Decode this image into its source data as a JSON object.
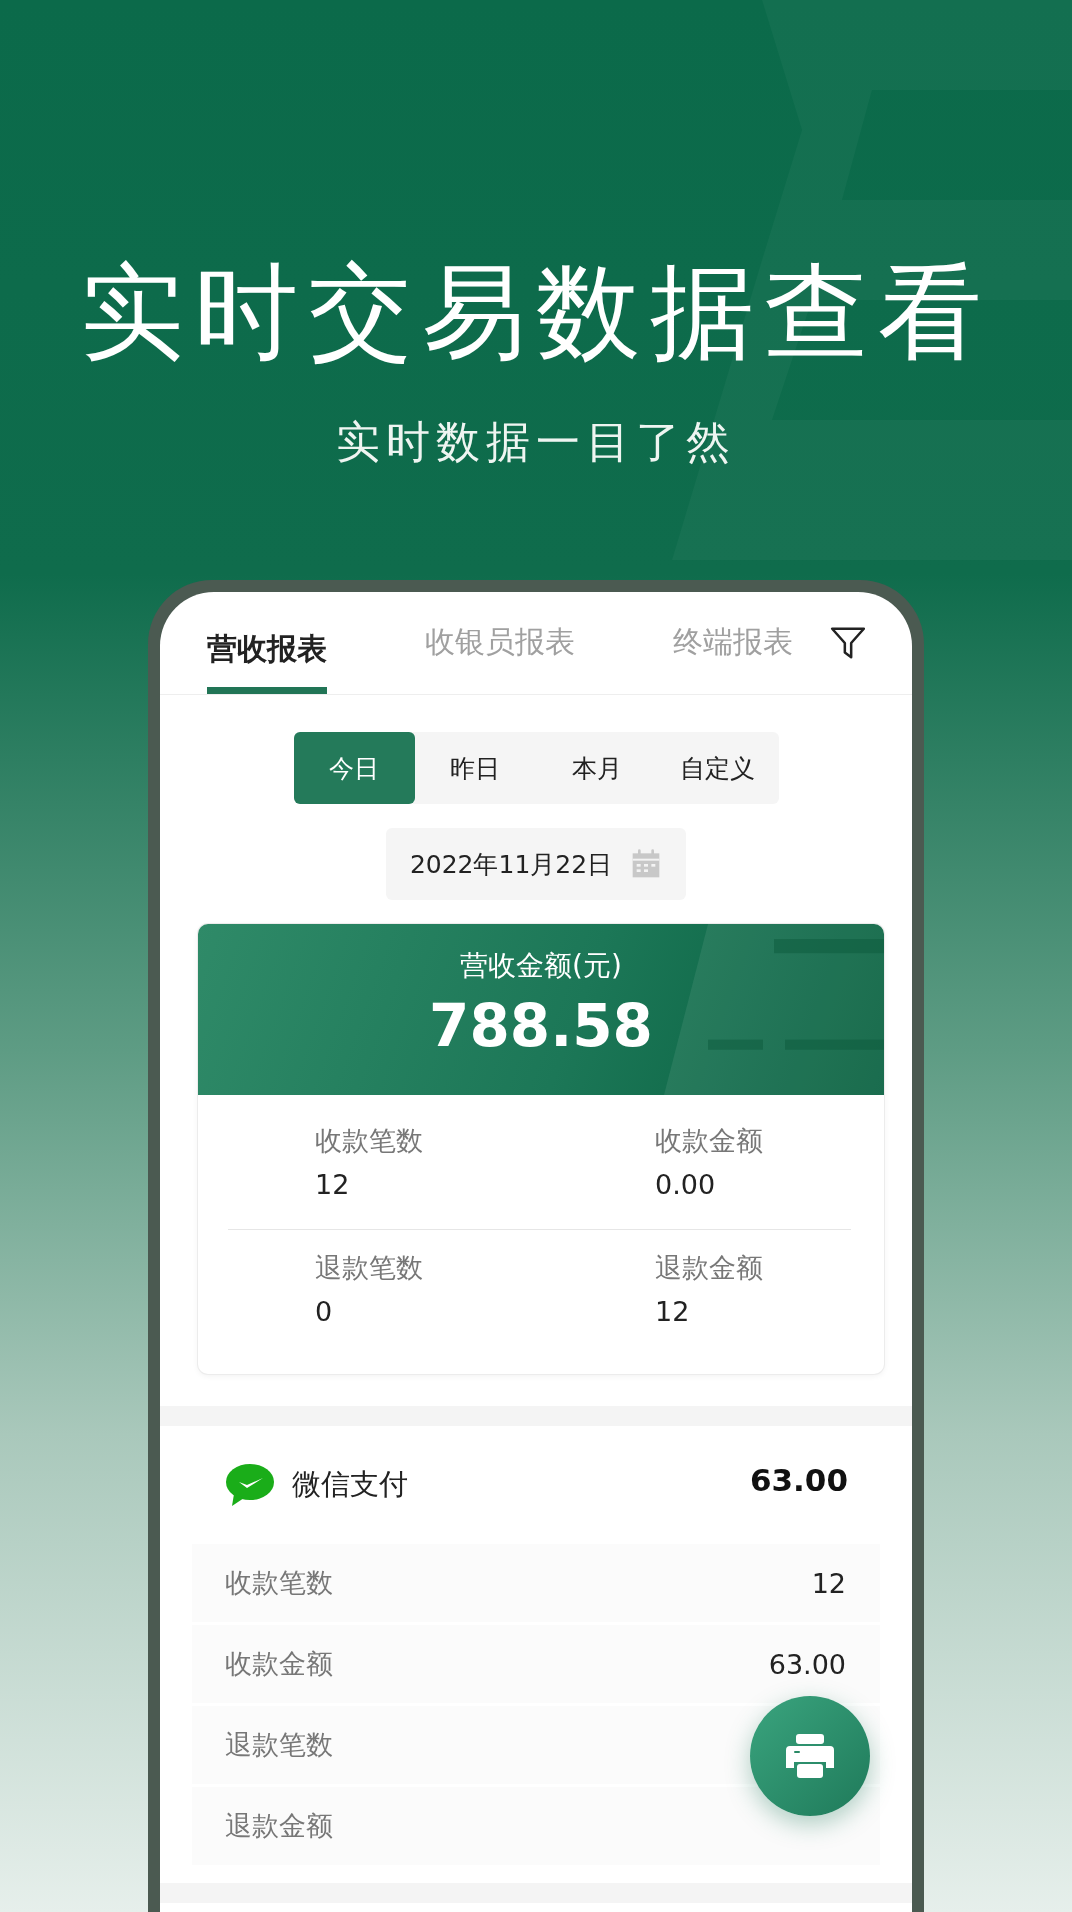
{
  "headline": "实时交易数据查看",
  "subtitle": "实时数据一目了然",
  "tabs": [
    {
      "label": "营收报表",
      "selected": true
    },
    {
      "label": "收银员报表",
      "selected": false
    },
    {
      "label": "终端报表",
      "selected": false
    }
  ],
  "period_options": [
    {
      "label": "今日",
      "selected": true
    },
    {
      "label": "昨日",
      "selected": false
    },
    {
      "label": "本月",
      "selected": false
    },
    {
      "label": "自定义",
      "selected": false
    }
  ],
  "date": "2022年11月22日",
  "summary": {
    "title": "营收金额(元)",
    "amount": "788.58",
    "stats": [
      {
        "label": "收款笔数",
        "value": "12"
      },
      {
        "label": "收款金额",
        "value": "0.00"
      },
      {
        "label": "退款笔数",
        "value": "0"
      },
      {
        "label": "退款金额",
        "value": "12"
      }
    ]
  },
  "payment_methods": [
    {
      "name": "微信支付",
      "total": "63.00",
      "rows": [
        {
          "label": "收款笔数",
          "value": "12"
        },
        {
          "label": "收款金额",
          "value": "63.00"
        },
        {
          "label": "退款笔数"
        },
        {
          "label": "退款金额"
        }
      ]
    }
  ]
}
